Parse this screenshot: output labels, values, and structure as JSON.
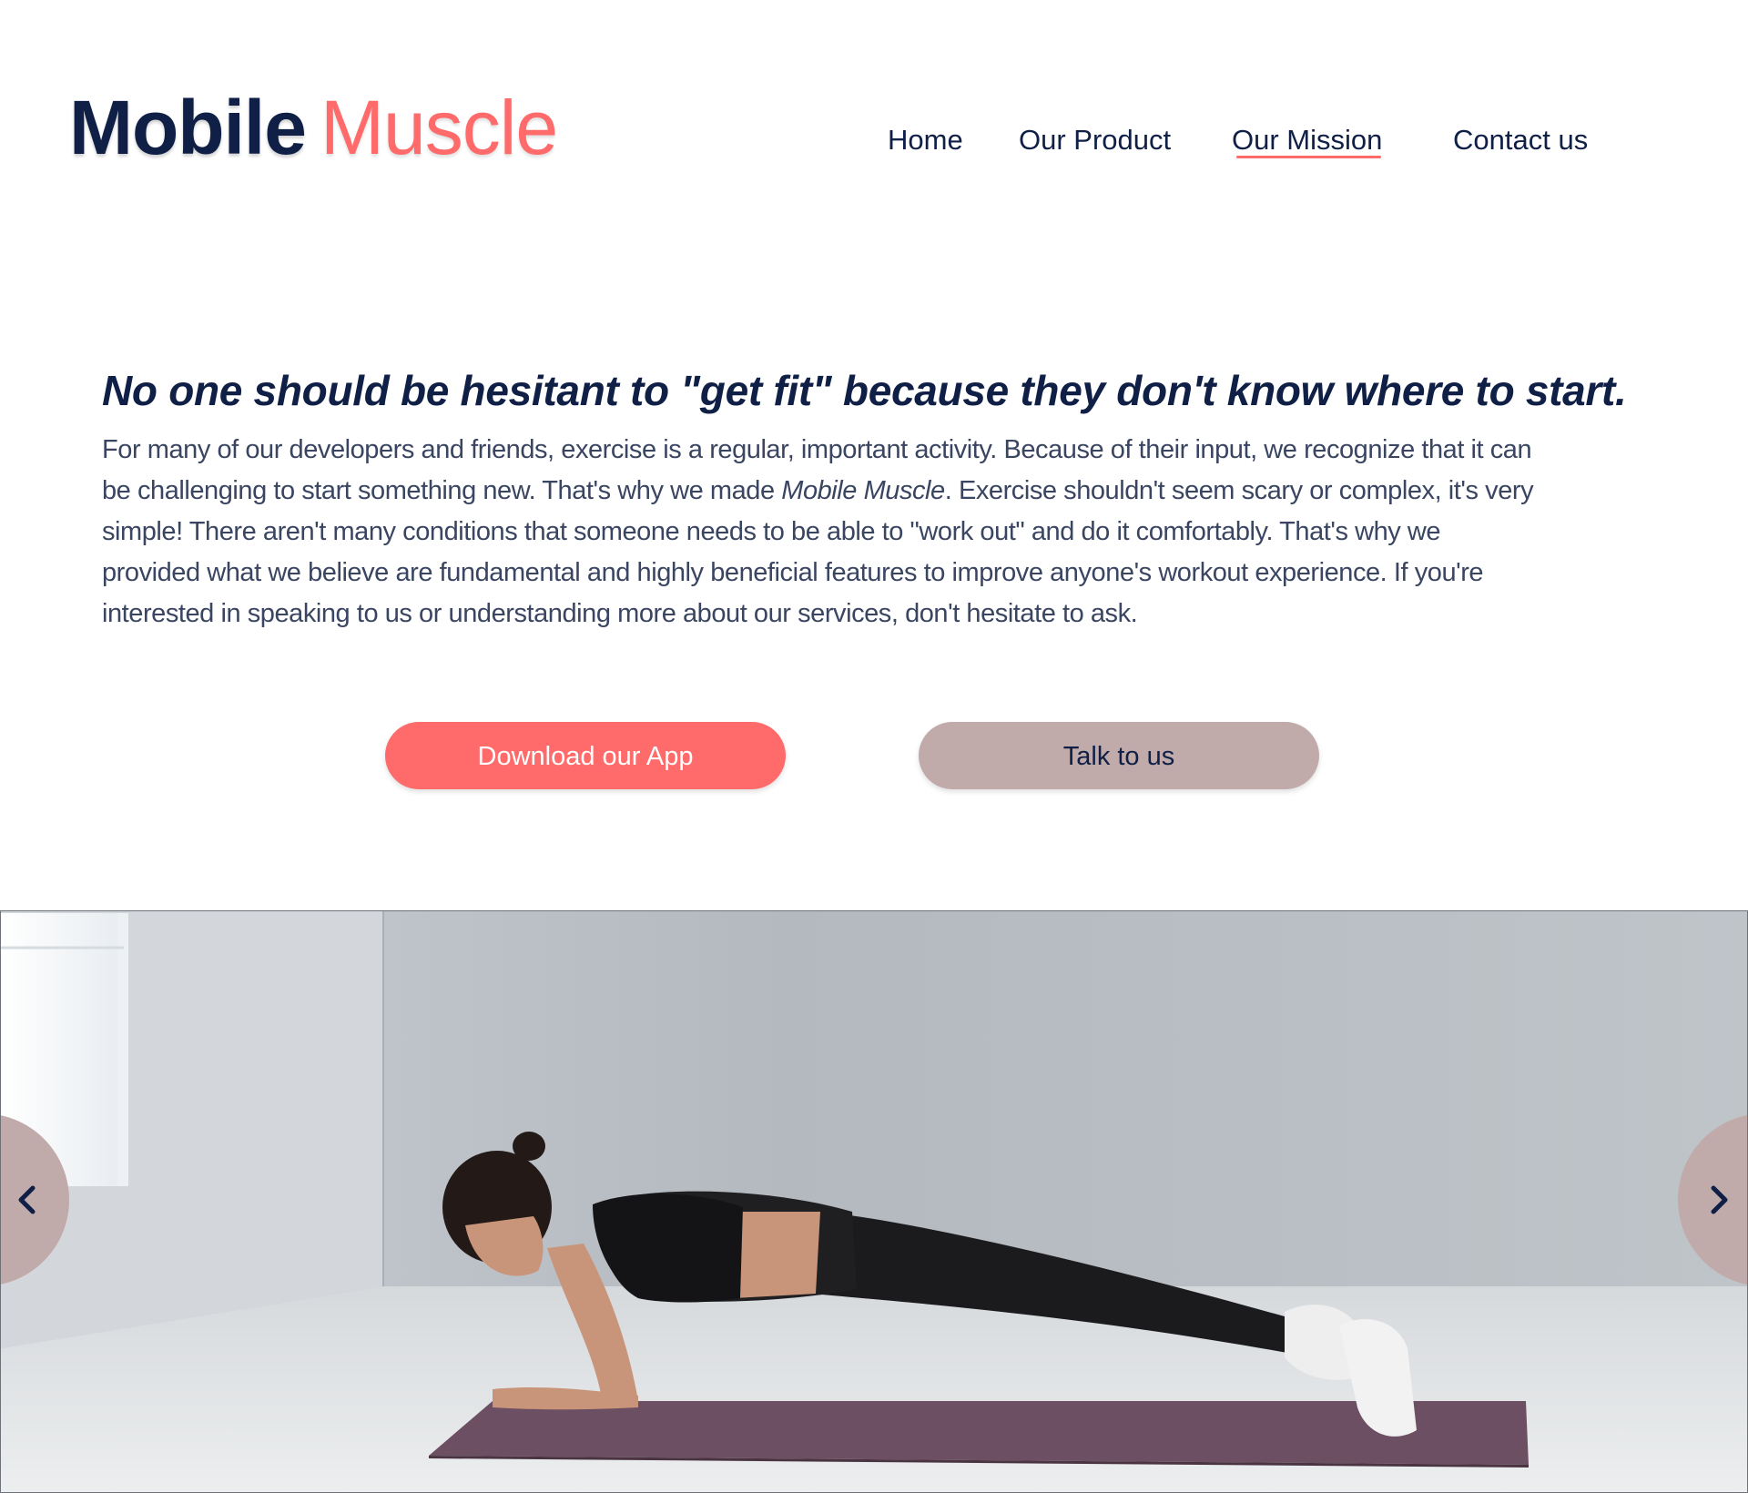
{
  "brand": {
    "name_primary": "Mobile",
    "name_accent": "Muscle",
    "colors": {
      "navy": "#0f1f46",
      "coral": "#ff6b6b",
      "mauve": "#c1abaa"
    }
  },
  "nav": {
    "items": [
      {
        "label": "Home",
        "active": false
      },
      {
        "label": "Our Product",
        "active": false
      },
      {
        "label": "Our Mission",
        "active": true
      },
      {
        "label": "Contact us",
        "active": false
      }
    ]
  },
  "mission": {
    "headline": "No one should be hesitant to \"get fit\" because they don't know where to start.",
    "paragraph_lines": [
      "For many of our developers and friends, exercise is a regular, important activity. Because of their input, we recognize that it can",
      "be challenging to start something new. That's why we made ",
      "Mobile Muscle",
      ". Exercise shouldn't seem scary or complex, it's very",
      "simple! There aren't many conditions that someone needs to be able to \"work out\" and do it comfortably. That's why we",
      "provided what we believe are fundamental and highly beneficial features to improve anyone's workout experience. If you're",
      "interested in speaking to us or understanding more about our services, don't hesitate to ask."
    ]
  },
  "buttons": {
    "download_label": "Download our App",
    "talk_label": "Talk to us"
  },
  "carousel": {
    "image_subject": "woman doing a forearm plank on a purple yoga mat in a bright studio",
    "prev_icon": "chevron-left-icon",
    "next_icon": "chevron-right-icon"
  }
}
